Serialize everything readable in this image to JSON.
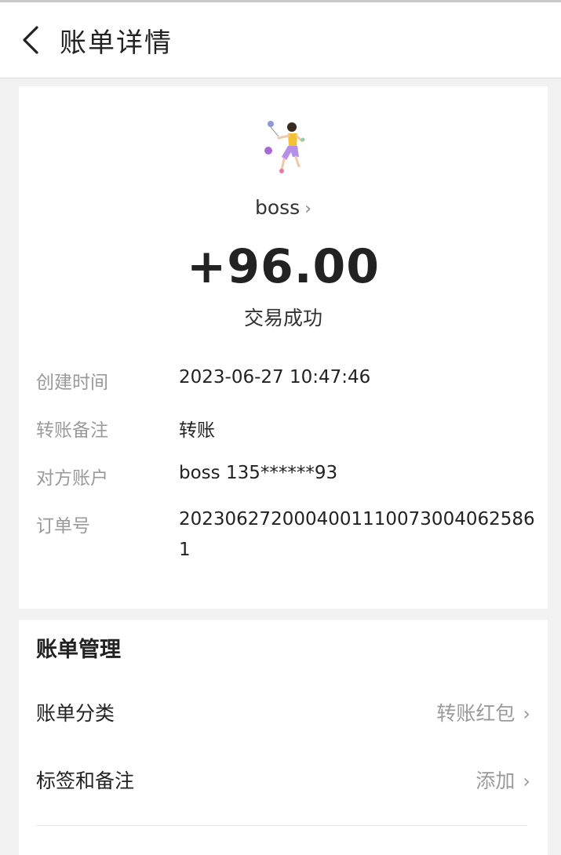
{
  "header": {
    "title": "账单详情",
    "back_icon": "chevron-left-icon"
  },
  "summary": {
    "avatar_icon": "girl-with-balloons-avatar",
    "name": "boss",
    "name_chevron": "›",
    "amount": "+96.00",
    "status": "交易成功"
  },
  "details": [
    {
      "label": "创建时间",
      "value": "2023-06-27 10:47:46"
    },
    {
      "label": "转账备注",
      "value": "转账"
    },
    {
      "label": "对方账户",
      "value": "boss 135******93"
    },
    {
      "label": "订单号",
      "value": "20230627200040011100730040625861"
    }
  ],
  "manage": {
    "title": "账单管理",
    "items": [
      {
        "label": "账单分类",
        "value": "转账红包",
        "chevron": "›"
      },
      {
        "label": "标签和备注",
        "value": "添加",
        "chevron": "›"
      }
    ]
  },
  "colors": {
    "background": "#f2f2f2",
    "card": "#ffffff",
    "label_gray": "#9a9a9a",
    "text_dark": "#222222"
  }
}
